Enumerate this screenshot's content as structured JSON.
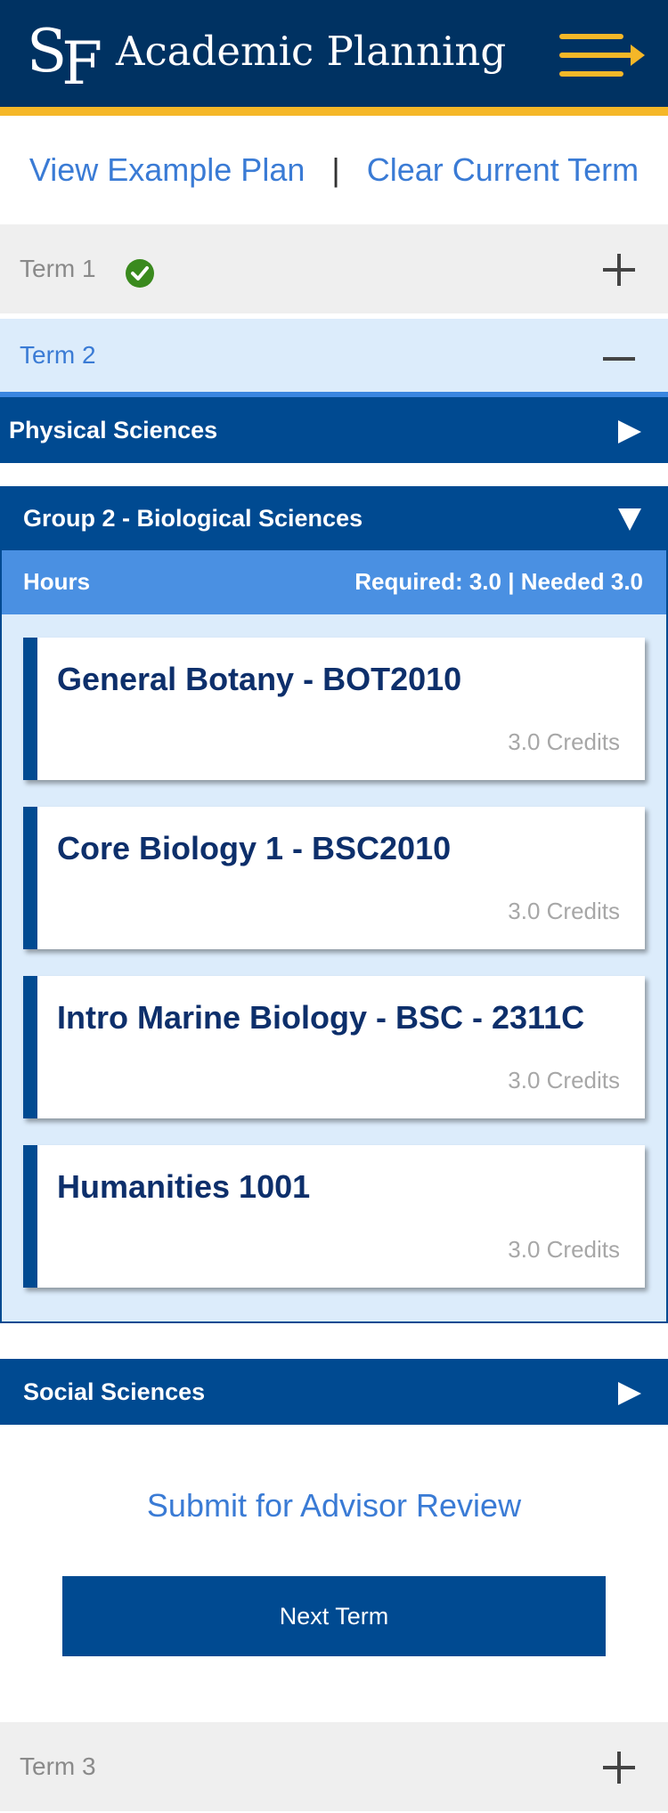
{
  "header": {
    "logo_s": "S",
    "logo_f": "F",
    "title": "Academic Planning",
    "menu_icon": "menu-arrow-icon",
    "accent_color": "#f5b728",
    "brand_color": "#003262"
  },
  "actions": {
    "view_example": "View Example Plan",
    "separator": "|",
    "clear_term": "Clear Current Term"
  },
  "terms": [
    {
      "label": "Term 1",
      "state": "collapsed",
      "completed": true,
      "toggle_icon": "plus-icon"
    },
    {
      "label": "Term 2",
      "state": "expanded",
      "completed": false,
      "toggle_icon": "minus-icon"
    },
    {
      "label": "Term 3",
      "state": "collapsed",
      "completed": false,
      "toggle_icon": "plus-icon"
    }
  ],
  "categories": {
    "physical": "Physical Sciences",
    "group2": "Group 2 - Biological Sciences",
    "social": "Social Sciences"
  },
  "hours": {
    "label": "Hours",
    "values": "Required: 3.0 | Needed 3.0"
  },
  "courses": [
    {
      "title": "General Botany - BOT2010",
      "credits": "3.0 Credits"
    },
    {
      "title": "Core Biology 1 - BSC2010",
      "credits": "3.0 Credits"
    },
    {
      "title": "Intro Marine Biology - BSC - 2311C",
      "credits": "3.0 Credits"
    },
    {
      "title": "Humanities 1001",
      "credits": "3.0 Credits"
    }
  ],
  "footer": {
    "submit": "Submit for Advisor Review",
    "next_term": "Next Term"
  }
}
